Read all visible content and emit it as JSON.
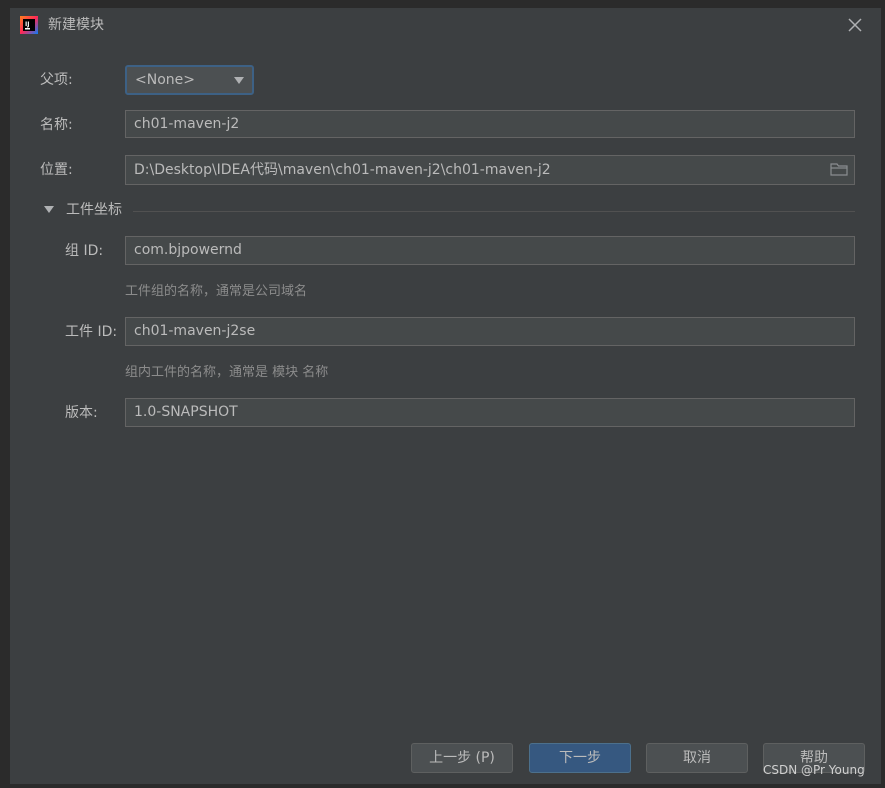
{
  "window": {
    "title": "新建模块",
    "app_icon": "intellij-idea-icon",
    "close_icon": "close-icon"
  },
  "form": {
    "parent": {
      "label": "父项:",
      "value": "<None>"
    },
    "name": {
      "label": "名称:",
      "value": "ch01-maven-j2"
    },
    "location": {
      "label": "位置:",
      "value": "D:\\Desktop\\IDEA代码\\maven\\ch01-maven-j2\\ch01-maven-j2",
      "browse_icon": "folder-icon"
    }
  },
  "artifact_coordinates": {
    "title": "工件坐标",
    "group_id": {
      "label": "组 ID:",
      "value": "com.bjpowernd",
      "hint": "工件组的名称，通常是公司域名"
    },
    "artifact_id": {
      "label": "工件 ID:",
      "value": "ch01-maven-j2se",
      "hint": "组内工件的名称，通常是 模块 名称"
    },
    "version": {
      "label": "版本:",
      "value": "1.0-SNAPSHOT"
    }
  },
  "buttons": {
    "previous": "上一步 (P)",
    "next": "下一步",
    "cancel": "取消",
    "help": "帮助"
  },
  "watermark": "CSDN @Pr Young",
  "colors": {
    "background": "#3c3f41",
    "field_background": "#45494a",
    "primary_button": "#365880",
    "focus_border": "#3d6185",
    "text": "#bbbbbb"
  }
}
